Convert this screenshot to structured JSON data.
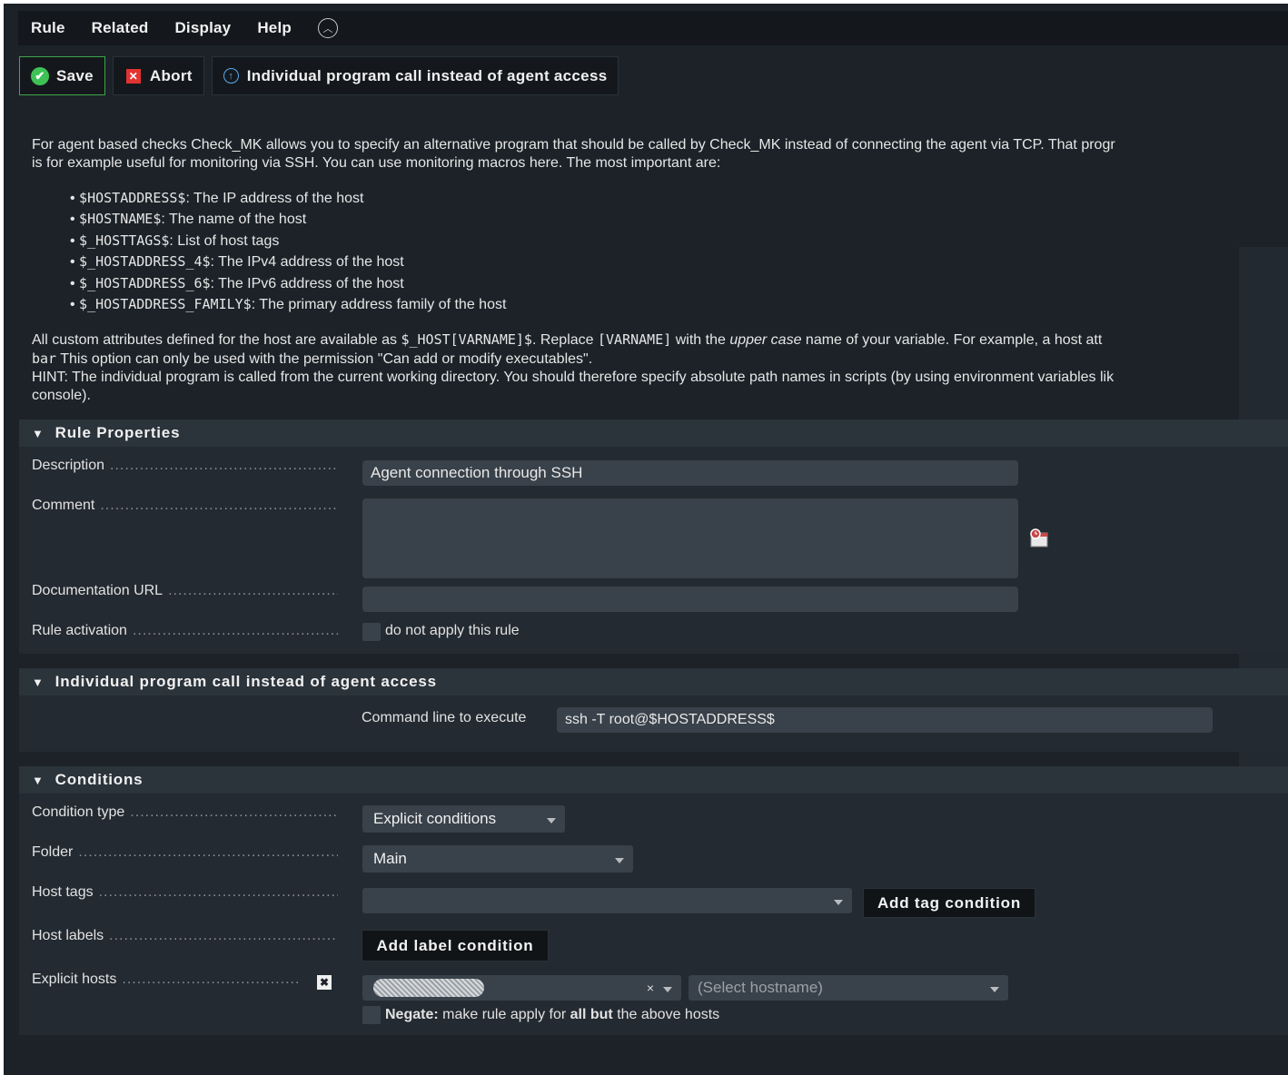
{
  "menu": [
    "Rule",
    "Related",
    "Display",
    "Help"
  ],
  "toolbar": {
    "save": "Save",
    "abort": "Abort",
    "individual": "Individual program call instead of agent access"
  },
  "help": {
    "intro_1": "For agent based checks Check_MK allows you to specify an alternative program that should be called by Check_MK instead of connecting the agent via TCP. That progr",
    "intro_2": "is for example useful for monitoring via SSH. You can use monitoring macros here. The most important are:",
    "macros": [
      {
        "code": "$HOSTADDRESS$",
        "text": ": The IP address of the host"
      },
      {
        "code": "$HOSTNAME$",
        "text": ": The name of the host"
      },
      {
        "code": "$_HOSTTAGS$",
        "text": ": List of host tags"
      },
      {
        "code": "$_HOSTADDRESS_4$",
        "text": ": The IPv4 address of the host"
      },
      {
        "code": "$_HOSTADDRESS_6$",
        "text": ": The IPv6 address of the host"
      },
      {
        "code": "$_HOSTADDRESS_FAMILY$",
        "text": ": The primary address family of the host"
      }
    ],
    "custom_a": "All custom attributes defined for the host are available as ",
    "custom_code": "$_HOST[VARNAME]$",
    "custom_b": ". Replace ",
    "custom_code2": "[VARNAME]",
    "custom_c": " with the ",
    "custom_ital": "upper case",
    "custom_d": " name of your variable. For example, a host att",
    "bar_code": "bar",
    "bar_text": " This option can only be used with the permission \"Can add or modify executables\".",
    "hint": "HINT: The individual program is called from the current working directory. You should therefore specify absolute path names in scripts (by using environment variables lik",
    "hint_2": "console)."
  },
  "rule_properties": {
    "title": "Rule Properties",
    "description_label": "Description",
    "description_value": "Agent connection through SSH",
    "comment_label": "Comment",
    "doc_url_label": "Documentation URL",
    "activation_label": "Rule activation",
    "activation_text": "do not apply this rule"
  },
  "individual": {
    "title": "Individual program call instead of agent access",
    "cmd_label": "Command line to execute",
    "cmd_value": "ssh -T root@$HOSTADDRESS$"
  },
  "conditions": {
    "title": "Conditions",
    "condition_type_label": "Condition type",
    "condition_type_value": "Explicit conditions",
    "folder_label": "Folder",
    "folder_value": "Main",
    "host_tags_label": "Host tags",
    "add_tag_button": "Add tag condition",
    "host_labels_label": "Host labels",
    "add_label_button": "Add label condition",
    "explicit_hosts_label": "Explicit hosts",
    "hostname_placeholder": "(Select hostname)",
    "negate_bold": "Negate:",
    "negate_a": " make rule apply for ",
    "negate_bold2": "all but",
    "negate_b": " the above hosts"
  },
  "colors": {
    "background": "#1c2228",
    "section": "#232a31",
    "input": "#39414a",
    "save_border": "#3ea54a",
    "abort_icon": "#e23232",
    "info_icon": "#5aa8f0"
  },
  "icons": [
    "collapse-icon",
    "check-icon",
    "abort-icon",
    "info-icon",
    "calendar-icon",
    "remove-icon",
    "dropdown-arrow-icon"
  ]
}
